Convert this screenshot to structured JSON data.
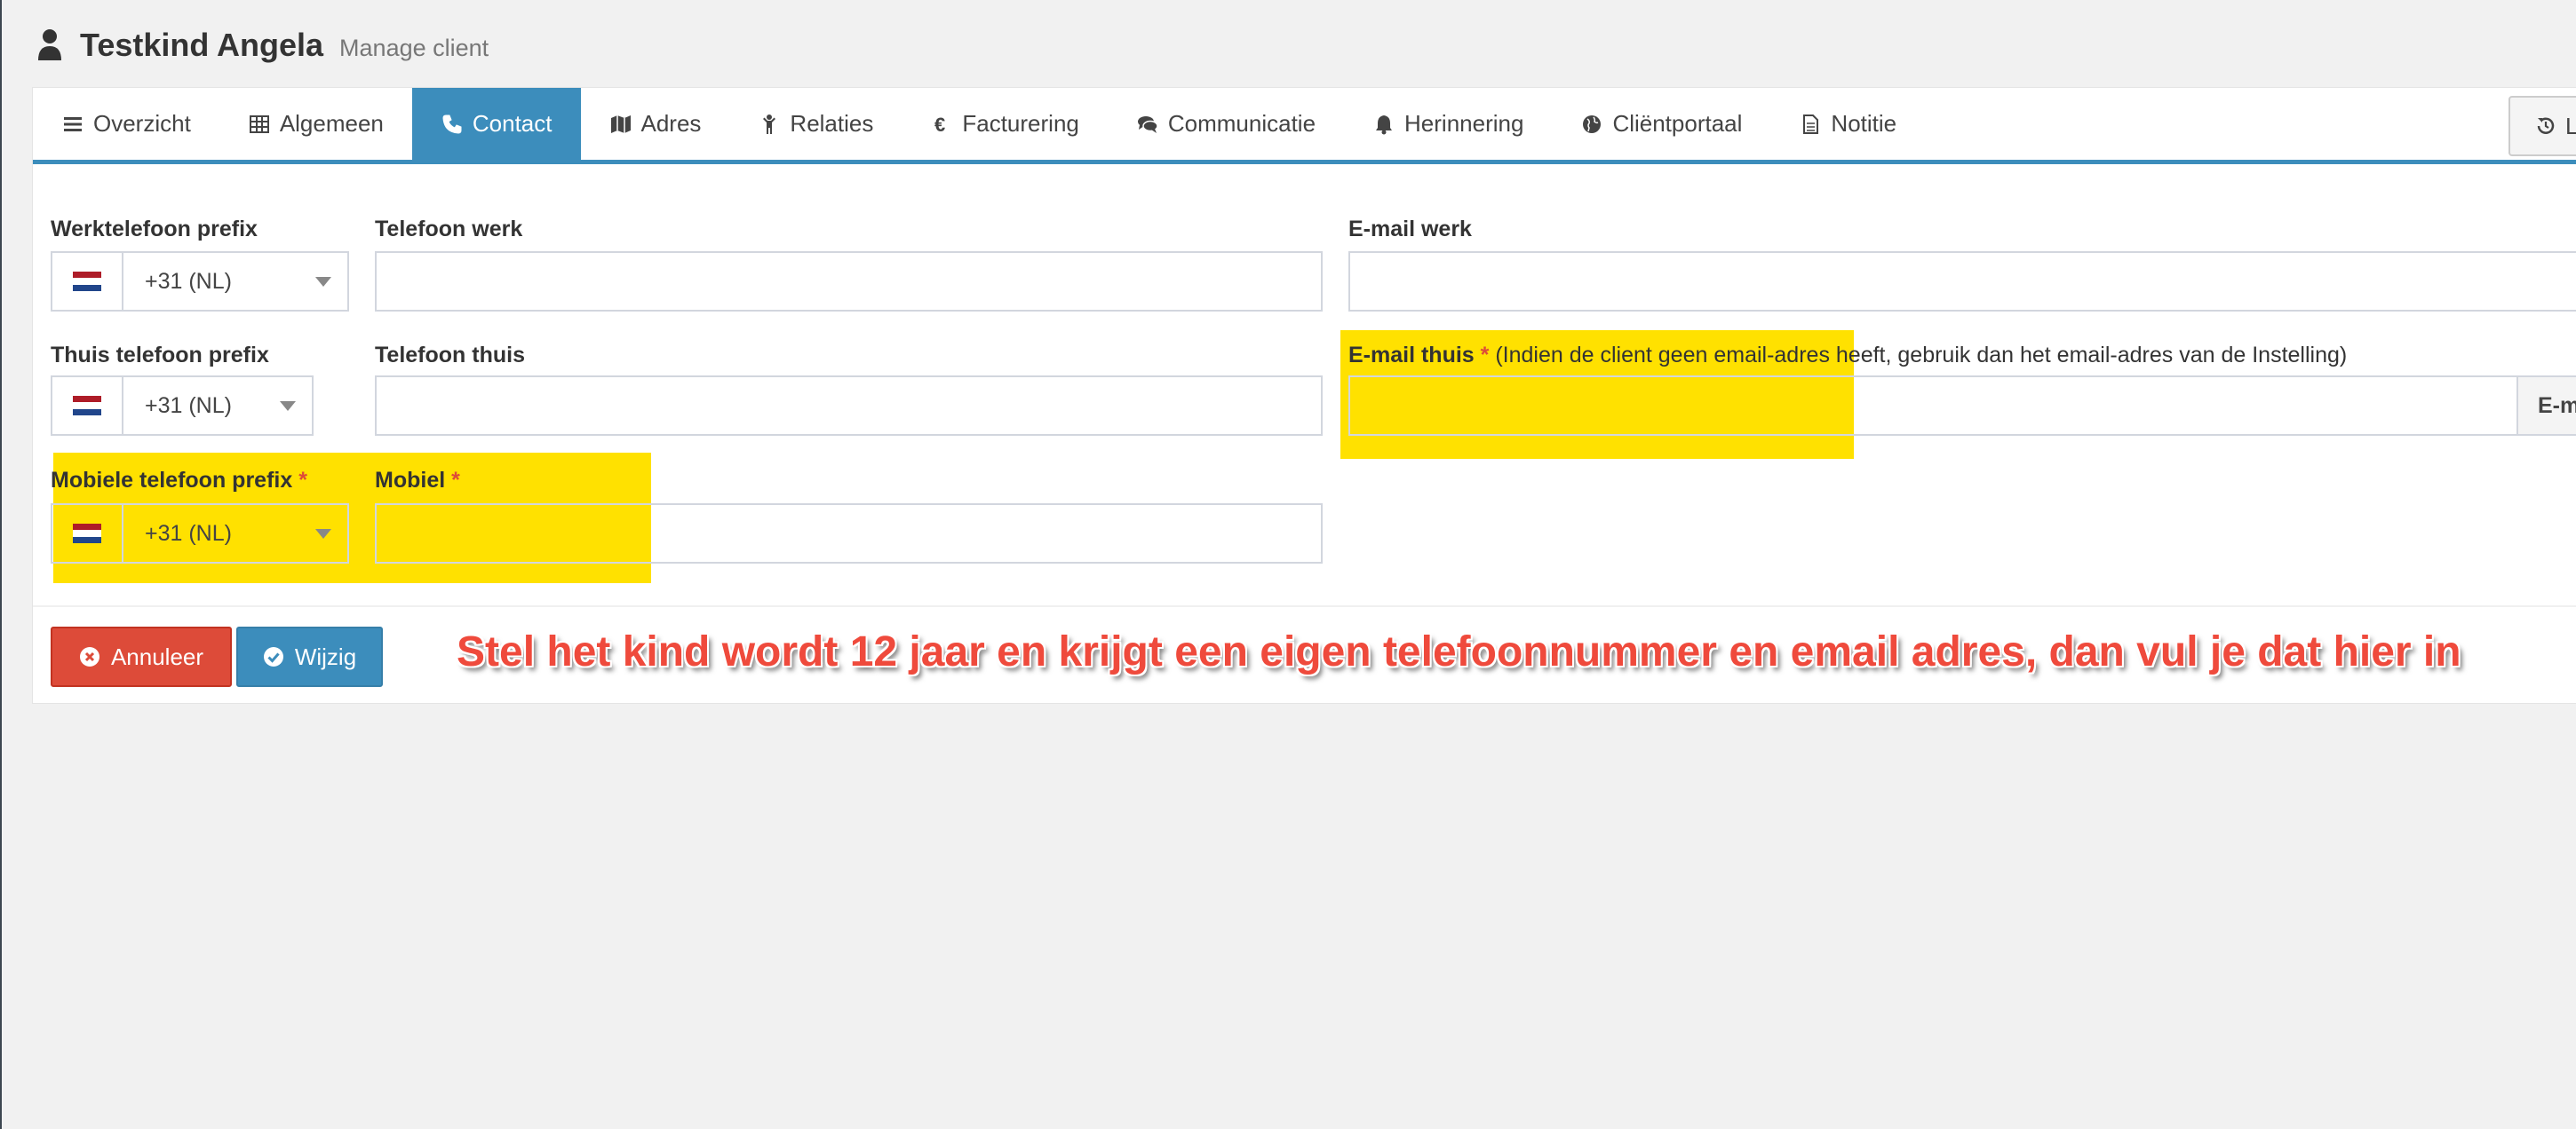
{
  "header": {
    "title": "Testkind Angela",
    "subtitle": "Manage client"
  },
  "tabs": [
    {
      "label": "Overzicht",
      "icon": "list-icon"
    },
    {
      "label": "Algemeen",
      "icon": "table-icon"
    },
    {
      "label": "Contact",
      "icon": "phone-icon",
      "active": true
    },
    {
      "label": "Adres",
      "icon": "map-icon"
    },
    {
      "label": "Relaties",
      "icon": "child-icon"
    },
    {
      "label": "Facturering",
      "icon": "euro-icon"
    },
    {
      "label": "Communicatie",
      "icon": "comments-icon"
    },
    {
      "label": "Herinnering",
      "icon": "bell-icon"
    },
    {
      "label": "Cliëntportaal",
      "icon": "globe-icon"
    },
    {
      "label": "Notitie",
      "icon": "file-icon"
    }
  ],
  "tab_right_button": {
    "label": "L",
    "icon": "history-icon"
  },
  "form": {
    "work_prefix": {
      "label": "Werktelefoon prefix",
      "value": "+31 (NL)"
    },
    "work_phone": {
      "label": "Telefoon werk",
      "value": ""
    },
    "work_email": {
      "label": "E-mail werk",
      "value": ""
    },
    "home_prefix": {
      "label": "Thuis telefoon prefix",
      "value": "+31 (NL)"
    },
    "home_phone": {
      "label": "Telefoon thuis",
      "value": ""
    },
    "home_email": {
      "label": "E-mail thuis",
      "required": "*",
      "note": "(Indien de client geen email-adres heeft, gebruik dan het email-adres van de Instelling)",
      "value": "",
      "addon": "E-mail"
    },
    "mobile_prefix": {
      "label": "Mobiele telefoon prefix",
      "required": "*",
      "value": "+31 (NL)"
    },
    "mobile": {
      "label": "Mobiel",
      "required": "*",
      "value": ""
    }
  },
  "buttons": {
    "cancel": "Annuleer",
    "save": "Wijzig"
  },
  "annotation": "Stel het kind wordt 12 jaar en krijgt een eigen telefoonnummer en email adres, dan vul je dat hier in",
  "colors": {
    "primary": "#3c8dbc",
    "danger": "#dd4b39",
    "highlight": "#ffe100",
    "annotation": "#ef4a3c"
  }
}
